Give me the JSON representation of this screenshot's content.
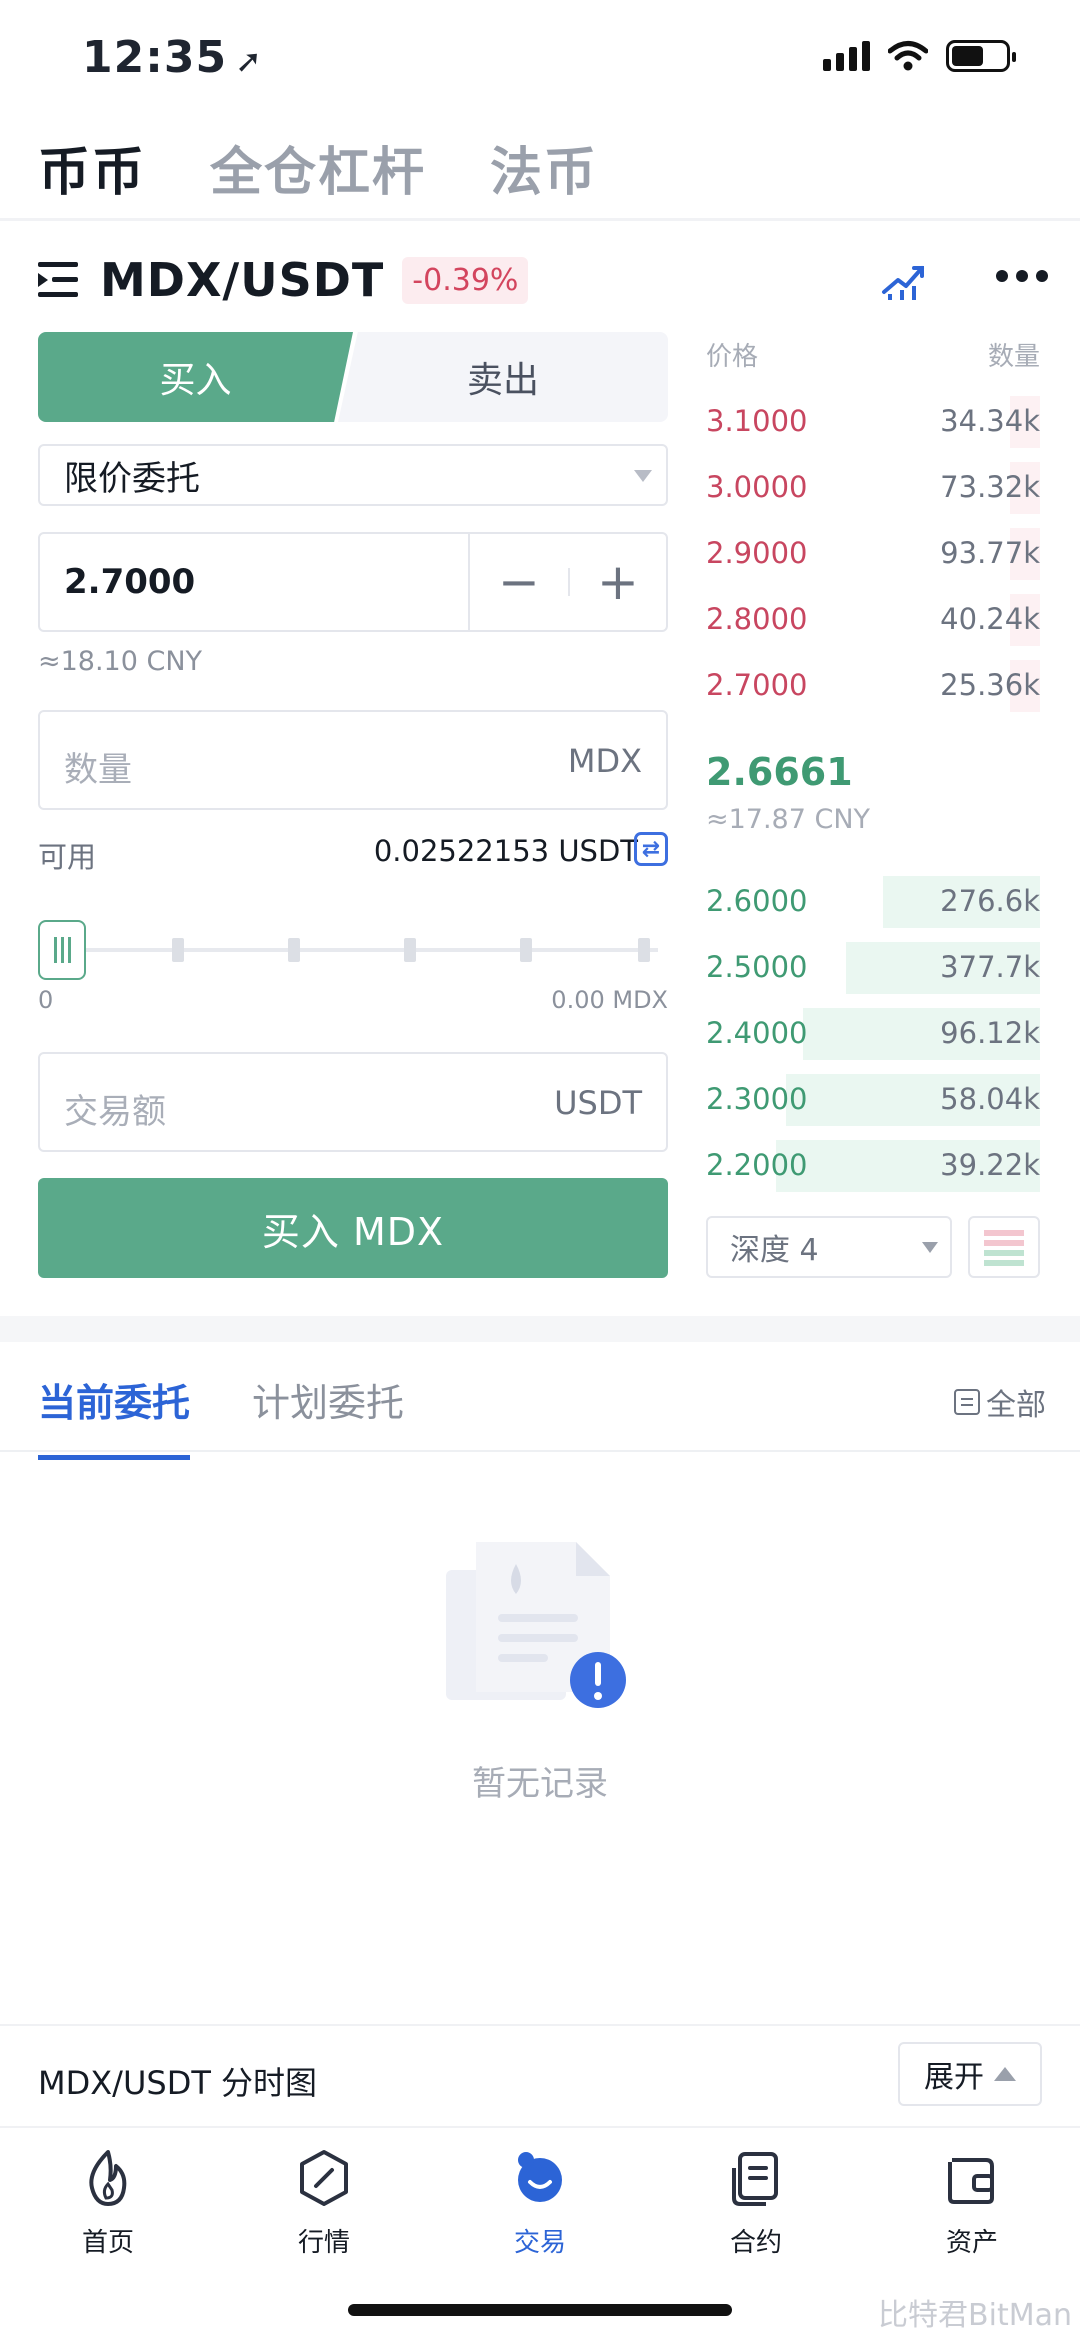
{
  "status": {
    "time": "12:35"
  },
  "top_tabs": [
    "币币",
    "全仓杠杆",
    "法币"
  ],
  "pair": {
    "name": "MDX/USDT",
    "change": "-0.39%"
  },
  "trade": {
    "buy_tab": "买入",
    "sell_tab": "卖出",
    "order_type": "限价委托",
    "price": "2.7000",
    "minus": "−",
    "plus": "+",
    "price_cny": "≈18.10 CNY",
    "qty_placeholder": "数量",
    "qty_unit": "MDX",
    "avail_label": "可用",
    "avail_value": "0.02522153 USDT",
    "transfer_glyph": "⇄",
    "slider_min": "0",
    "slider_max": "0.00 MDX",
    "amount_placeholder": "交易额",
    "amount_unit": "USDT",
    "buy_button": "买入 MDX"
  },
  "orderbook": {
    "price_header": "价格",
    "qty_header": "数量",
    "asks": [
      {
        "price": "3.1000",
        "qty": "34.34k",
        "depth": 0.09
      },
      {
        "price": "3.0000",
        "qty": "73.32k",
        "depth": 0.09
      },
      {
        "price": "2.9000",
        "qty": "93.77k",
        "depth": 0.09
      },
      {
        "price": "2.8000",
        "qty": "40.24k",
        "depth": 0.09
      },
      {
        "price": "2.7000",
        "qty": "25.36k",
        "depth": 0.09
      }
    ],
    "last_price": "2.6661",
    "last_cny": "≈17.87 CNY",
    "bids": [
      {
        "price": "2.6000",
        "qty": "276.6k",
        "depth": 0.47
      },
      {
        "price": "2.5000",
        "qty": "377.7k",
        "depth": 0.58
      },
      {
        "price": "2.4000",
        "qty": "96.12k",
        "depth": 0.71
      },
      {
        "price": "2.3000",
        "qty": "58.04k",
        "depth": 0.76
      },
      {
        "price": "2.2000",
        "qty": "39.22k",
        "depth": 0.79
      }
    ],
    "depth_select": "深度 4"
  },
  "orders": {
    "tabs": [
      "当前委托",
      "计划委托"
    ],
    "all_label": "全部",
    "empty_text": "暂无记录"
  },
  "chart_bar": {
    "title": "MDX/USDT 分时图",
    "expand": "展开"
  },
  "nav": [
    {
      "label": "首页",
      "icon": "flame-icon"
    },
    {
      "label": "行情",
      "icon": "market-icon"
    },
    {
      "label": "交易",
      "icon": "trade-icon"
    },
    {
      "label": "合约",
      "icon": "contract-icon"
    },
    {
      "label": "资产",
      "icon": "wallet-icon"
    }
  ],
  "watermark": "比特君BitMan",
  "colors": {
    "buy": "#5aa98a",
    "sell": "#c84660",
    "accent": "#2c64d6"
  }
}
